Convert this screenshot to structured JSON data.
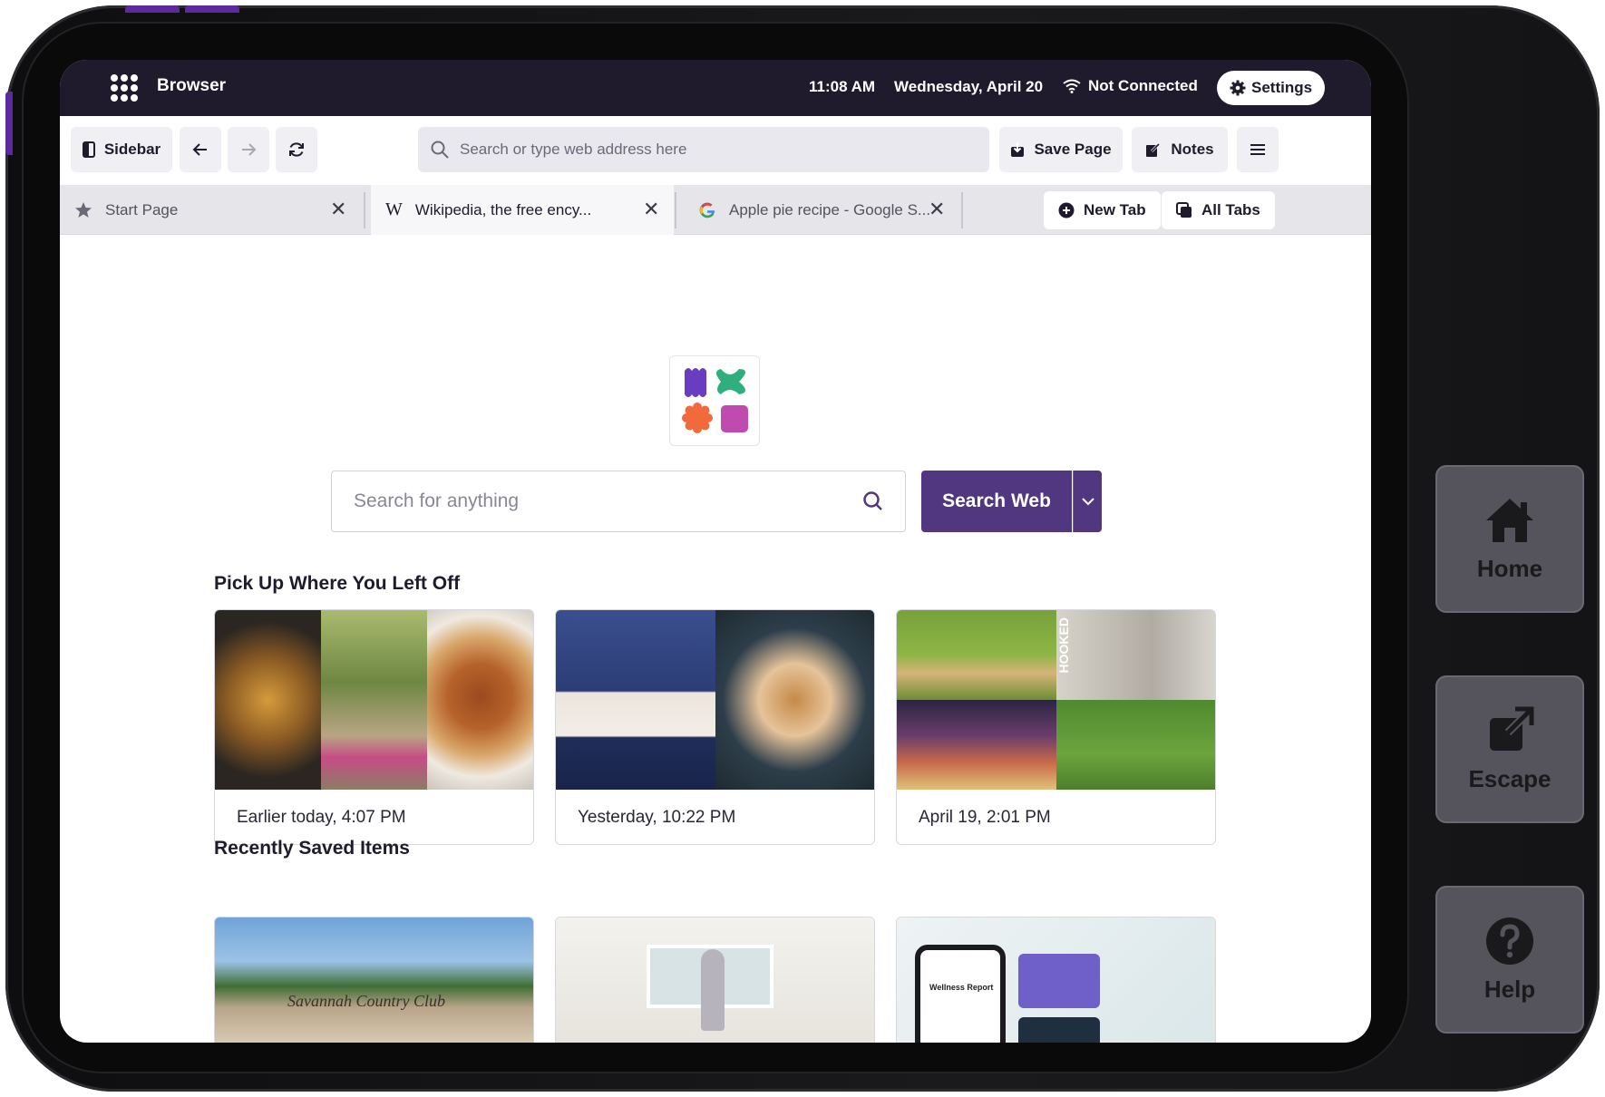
{
  "system_bar": {
    "app_name": "Browser",
    "time": "11:08 AM",
    "date": "Wednesday, April 20",
    "connection": "Not Connected",
    "settings_label": "Settings"
  },
  "toolbar": {
    "sidebar_label": "Sidebar",
    "address_placeholder": "Search or type web address here",
    "save_page_label": "Save Page",
    "notes_label": "Notes"
  },
  "tabs": [
    {
      "label": "Start Page",
      "icon": "star-icon"
    },
    {
      "label": "Wikipedia, the free ency...",
      "icon": "wikipedia-icon"
    },
    {
      "label": "Apple pie recipe - Google S...",
      "icon": "google-icon"
    }
  ],
  "tab_actions": {
    "new_tab_label": "New Tab",
    "all_tabs_label": "All Tabs"
  },
  "search": {
    "placeholder": "Search for anything",
    "button_label": "Search Web"
  },
  "sections": {
    "pick_up": "Pick Up Where You Left Off",
    "recently_saved": "Recently Saved Items"
  },
  "history_cards": [
    {
      "label": "Earlier today, 4:07 PM"
    },
    {
      "label": "Yesterday, 10:22 PM"
    },
    {
      "label": "April 19, 2:01 PM"
    }
  ],
  "side_buttons": {
    "home": "Home",
    "escape": "Escape",
    "help": "Help"
  },
  "thumb_text": {
    "country_club": "Savannah Country Club",
    "hooked": "HOOKED",
    "wellness": "Wellness Report"
  },
  "colors": {
    "accent": "#51377f",
    "system_bar": "#1f1b2d",
    "device_buttons": "#5b2a9c"
  }
}
